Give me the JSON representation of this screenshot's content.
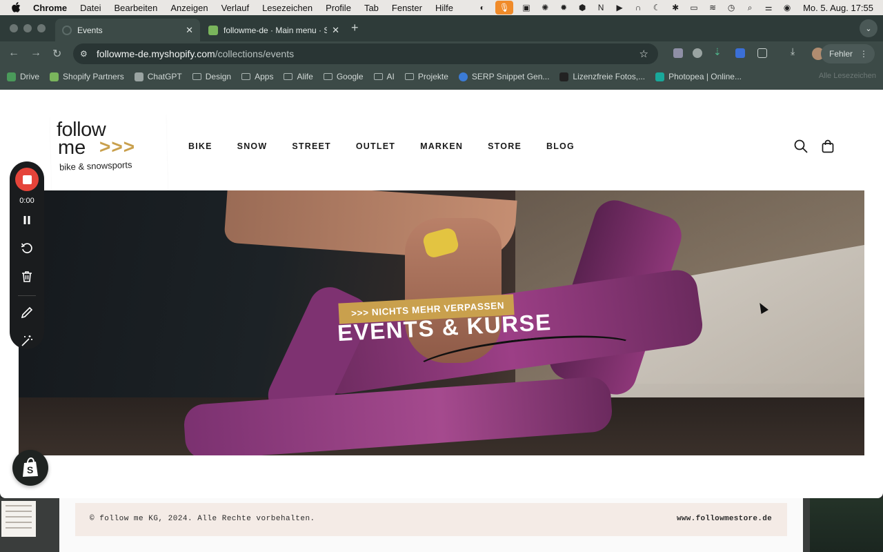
{
  "menubar": {
    "app": "Chrome",
    "items": [
      "Datei",
      "Bearbeiten",
      "Anzeigen",
      "Verlauf",
      "Lesezeichen",
      "Profile",
      "Tab",
      "Fenster",
      "Hilfe"
    ],
    "clock": "Mo. 5. Aug.  17:55"
  },
  "tabs": [
    {
      "title": "Events",
      "active": true
    },
    {
      "title": "followme-de · Main menu · Sh",
      "active": false
    }
  ],
  "omnibox": {
    "host": "followme-de.myshopify.com",
    "path": "/collections/events"
  },
  "toolbar": {
    "error_label": "Fehler"
  },
  "bookmarks": [
    {
      "label": "Drive",
      "folder": false,
      "color": "#4a9a5a"
    },
    {
      "label": "Shopify Partners",
      "folder": false,
      "color": "#7ab55c"
    },
    {
      "label": "ChatGPT",
      "folder": false,
      "color": "#9aa4a2"
    },
    {
      "label": "Design",
      "folder": true
    },
    {
      "label": "Apps",
      "folder": true
    },
    {
      "label": "Alife",
      "folder": true
    },
    {
      "label": "Google",
      "folder": true
    },
    {
      "label": "AI",
      "folder": true
    },
    {
      "label": "Projekte",
      "folder": true
    },
    {
      "label": "SERP Snippet Gen...",
      "folder": false,
      "color": "#3b7bd6"
    },
    {
      "label": "Lizenzfreie Fotos,...",
      "folder": false,
      "color": "#222222"
    },
    {
      "label": "Photopea | Online...",
      "folder": false,
      "color": "#19a89a"
    }
  ],
  "bookmarks_all": "Alle Lesezeichen",
  "site": {
    "logo": {
      "line1": "follow",
      "line2": "me",
      "arrows": ">>>",
      "tagline": "bike & snowsports"
    },
    "nav": [
      "BIKE",
      "SNOW",
      "STREET",
      "OUTLET",
      "MARKEN",
      "STORE",
      "BLOG"
    ],
    "hero": {
      "tag": ">>> NICHTS MEHR VERPASSEN",
      "title": "EVENTS & KURSE"
    },
    "accent": "#c9a04d"
  },
  "recorder": {
    "time": "0:00"
  },
  "under_footer": {
    "copyright": "© follow me KG, 2024. Alle Rechte vorbehalten.",
    "url": "www.followmestore.de"
  }
}
